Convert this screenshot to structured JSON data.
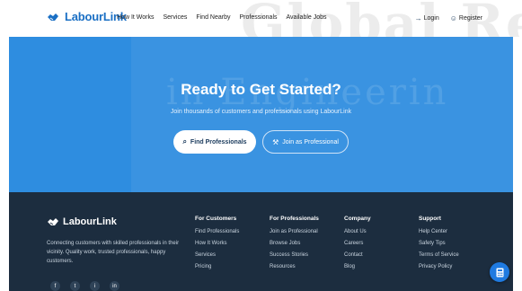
{
  "header": {
    "logo": "LabourLink",
    "watermark": "Global Re",
    "nav": [
      "How It Works",
      "Services",
      "Find Nearby",
      "Professionals",
      "Available Jobs"
    ],
    "login": "Login",
    "register": "Register"
  },
  "hero": {
    "watermark": "in Engineerin",
    "title": "Ready to Get Started?",
    "subtitle": "Join thousands of customers and professionals using LabourLink",
    "primary_button": "Find Professionals",
    "secondary_button": "Join as Professional"
  },
  "footer": {
    "logo": "LabourLink",
    "description": "Connecting customers with skilled professionals in their vicinity. Quality work, trusted professionals, happy customers.",
    "social": [
      "f",
      "t",
      "i",
      "in"
    ],
    "columns": [
      {
        "title": "For Customers",
        "items": [
          "Find Professionals",
          "How It Works",
          "Services",
          "Pricing"
        ]
      },
      {
        "title": "For Professionals",
        "items": [
          "Join as Professional",
          "Browse Jobs",
          "Success Stories",
          "Resources"
        ]
      },
      {
        "title": "Company",
        "items": [
          "About Us",
          "Careers",
          "Contact",
          "Blog"
        ]
      },
      {
        "title": "Support",
        "items": [
          "Help Center",
          "Safety Tips",
          "Terms of Service",
          "Privacy Policy"
        ]
      }
    ]
  },
  "colors": {
    "primary": "#1a6fc4",
    "hero_bg": "#2e8de0",
    "footer_bg": "#1c2d3f",
    "fab": "#1f7ae0"
  },
  "icons": {
    "logo": "handshake-icon",
    "login": "sign-in-icon",
    "register": "user-plus-icon",
    "search": "search-icon",
    "tools": "tools-icon",
    "fab": "calculator-icon"
  }
}
